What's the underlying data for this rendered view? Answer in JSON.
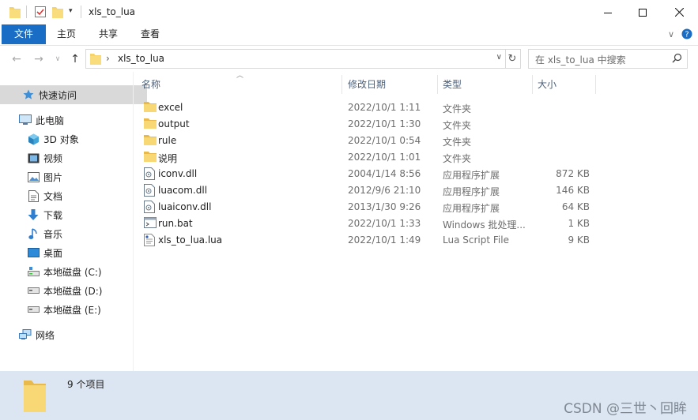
{
  "window": {
    "title": "xls_to_lua",
    "minimize_icon": "minimize-icon",
    "maximize_icon": "maximize-icon",
    "close_icon": "close-icon"
  },
  "ribbon": {
    "tabs": [
      {
        "label": "文件",
        "active": true
      },
      {
        "label": "主页"
      },
      {
        "label": "共享"
      },
      {
        "label": "查看"
      }
    ],
    "accent_color": "#1a6dc4"
  },
  "address": {
    "path_segment": "xls_to_lua",
    "separator": "›"
  },
  "search": {
    "placeholder": "在 xls_to_lua 中搜索"
  },
  "sidebar": {
    "items": [
      {
        "label": "快速访问",
        "icon": "star-icon"
      },
      {
        "label": "此电脑",
        "icon": "computer-icon"
      },
      {
        "label": "3D 对象",
        "icon": "cube-icon"
      },
      {
        "label": "视频",
        "icon": "video-icon"
      },
      {
        "label": "图片",
        "icon": "picture-icon"
      },
      {
        "label": "文档",
        "icon": "document-icon"
      },
      {
        "label": "下载",
        "icon": "download-icon"
      },
      {
        "label": "音乐",
        "icon": "music-icon"
      },
      {
        "label": "桌面",
        "icon": "desktop-icon"
      },
      {
        "label": "本地磁盘 (C:)",
        "icon": "drive-icon"
      },
      {
        "label": "本地磁盘 (D:)",
        "icon": "drive-icon"
      },
      {
        "label": "本地磁盘 (E:)",
        "icon": "drive-icon"
      },
      {
        "label": "网络",
        "icon": "network-icon"
      }
    ]
  },
  "columns": {
    "name": "名称",
    "date": "修改日期",
    "type": "类型",
    "size": "大小"
  },
  "files": [
    {
      "name": "excel",
      "date": "2022/10/1 1:11",
      "type": "文件夹",
      "size": "",
      "icon": "folder-icon"
    },
    {
      "name": "output",
      "date": "2022/10/1 1:30",
      "type": "文件夹",
      "size": "",
      "icon": "folder-icon"
    },
    {
      "name": "rule",
      "date": "2022/10/1 0:54",
      "type": "文件夹",
      "size": "",
      "icon": "folder-icon"
    },
    {
      "name": "说明",
      "date": "2022/10/1 1:01",
      "type": "文件夹",
      "size": "",
      "icon": "folder-icon"
    },
    {
      "name": "iconv.dll",
      "date": "2004/1/14 8:56",
      "type": "应用程序扩展",
      "size": "872 KB",
      "icon": "dll-file-icon"
    },
    {
      "name": "luacom.dll",
      "date": "2012/9/6 21:10",
      "type": "应用程序扩展",
      "size": "146 KB",
      "icon": "dll-file-icon"
    },
    {
      "name": "luaiconv.dll",
      "date": "2013/1/30 9:26",
      "type": "应用程序扩展",
      "size": "64 KB",
      "icon": "dll-file-icon"
    },
    {
      "name": "run.bat",
      "date": "2022/10/1 1:33",
      "type": "Windows 批处理...",
      "size": "1 KB",
      "icon": "bat-file-icon"
    },
    {
      "name": "xls_to_lua.lua",
      "date": "2022/10/1 1:49",
      "type": "Lua Script File",
      "size": "9 KB",
      "icon": "lua-file-icon"
    }
  ],
  "status": {
    "item_count": "9 个项目"
  },
  "watermark": "CSDN @三世丶回眸"
}
